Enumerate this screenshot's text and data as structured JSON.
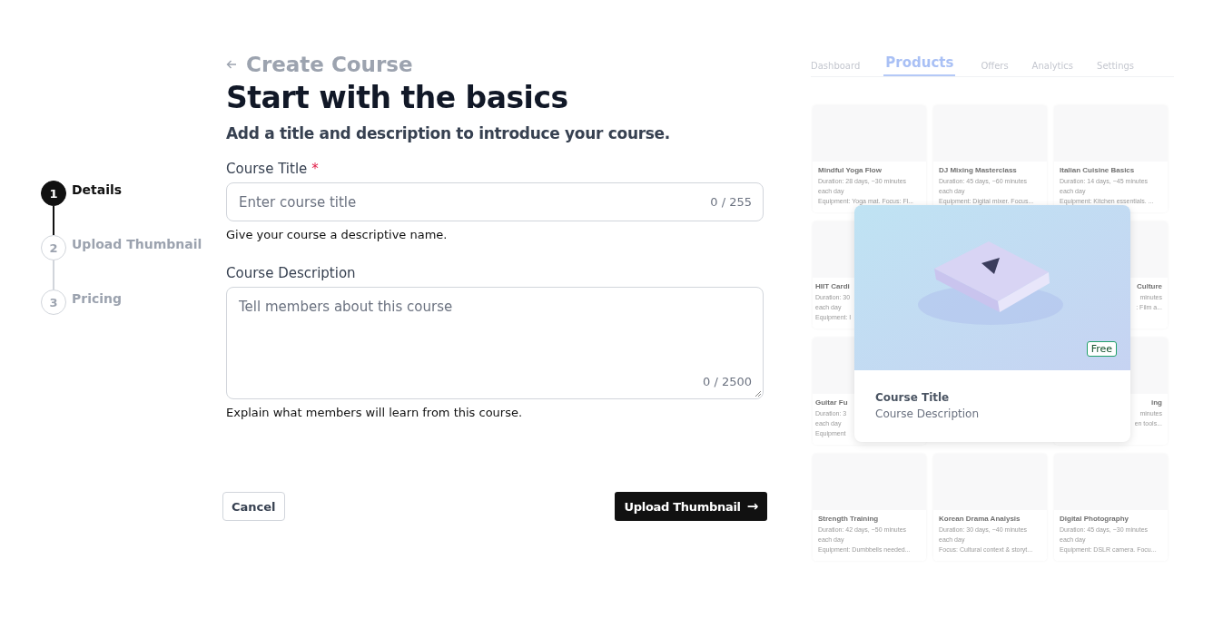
{
  "steps": [
    {
      "number": "1",
      "label": "Details",
      "selected": true
    },
    {
      "number": "2",
      "label": "Upload Thumbnail",
      "selected": false
    },
    {
      "number": "3",
      "label": "Pricing",
      "selected": false
    }
  ],
  "header": {
    "back_title": "Create Course",
    "title": "Start with the basics",
    "subtitle": "Add a title and description to introduce your course."
  },
  "fields": [
    {
      "kind": "input",
      "label": "Course Title",
      "required_mark": "*",
      "placeholder": "Enter course title",
      "counter": "0 / 255",
      "hint": "Give your course a descriptive name."
    },
    {
      "kind": "textarea",
      "label": "Course Description",
      "placeholder": "Tell members about this course",
      "counter": "0 / 2500",
      "hint": "Explain what members will learn from this course."
    }
  ],
  "buttons": {
    "cancel": "Cancel",
    "next": "Upload Thumbnail",
    "next_icon": "→"
  },
  "preview": {
    "tabs": [
      {
        "label": "Dashboard",
        "selected": false
      },
      {
        "label": "Products",
        "selected": true
      },
      {
        "label": "Offers",
        "selected": false
      },
      {
        "label": "Analytics",
        "selected": false
      },
      {
        "label": "Settings",
        "selected": false
      }
    ],
    "rows": [
      {
        "cards": [
          {
            "kind": "full",
            "title": "Mindful Yoga Flow",
            "lines": [
              "Duration: 28 days, ~30 minutes",
              "each day",
              "Equipment: Yoga mat. Focus: Fl..."
            ]
          },
          {
            "kind": "full",
            "title": "DJ Mixing Masterclass",
            "lines": [
              "Duration: 45 days, ~60 minutes",
              "each day",
              "Equipment: Digital mixer. Focus..."
            ]
          },
          {
            "kind": "full",
            "title": "Italian Cuisine Basics",
            "lines": [
              "Duration: 14 days, ~45 minutes",
              "each day",
              "Equipment: Kitchen essentials. ..."
            ]
          }
        ]
      },
      {
        "cards": [
          {
            "kind": "covered_right",
            "title": "HIIT Cardi",
            "lines": [
              "Duration: 30",
              "each day",
              "Equipment: I"
            ]
          },
          {
            "kind": "hidden"
          },
          {
            "kind": "covered_left",
            "title": "Culture",
            "lines": [
              "minutes",
              ": Film a..."
            ]
          }
        ]
      },
      {
        "cards": [
          {
            "kind": "covered_right",
            "title": "Guitar Fu",
            "lines": [
              "Duration: 3",
              "each day",
              "Equipment"
            ]
          },
          {
            "kind": "hidden"
          },
          {
            "kind": "covered_left",
            "title": "ing",
            "lines": [
              "minutes",
              "en tools..."
            ]
          }
        ]
      },
      {
        "cards": [
          {
            "kind": "full",
            "title": "Strength Training",
            "lines": [
              "Duration: 42 days, ~50 minutes",
              "each day",
              "Equipment: Dumbbells needed..."
            ]
          },
          {
            "kind": "full",
            "title": "Korean Drama Analysis",
            "lines": [
              "Duration: 30 days, ~40 minutes",
              "each day",
              "Focus: Cultural context & storyt..."
            ]
          },
          {
            "kind": "full",
            "title": "Digital Photography",
            "lines": [
              "Duration: 45 days, ~30 minutes",
              "each day",
              "Equipment: DSLR camera. Focu..."
            ]
          }
        ]
      }
    ],
    "course_card": {
      "badge": "Free",
      "title": "Course Title",
      "description": "Course Description"
    }
  }
}
